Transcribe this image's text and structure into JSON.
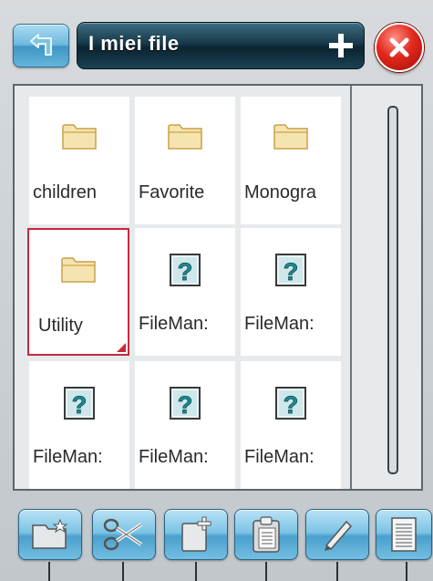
{
  "header": {
    "title": "I miei file"
  },
  "files": [
    {
      "label": "children",
      "type": "folder",
      "selected": false
    },
    {
      "label": "Favorite",
      "type": "folder",
      "selected": false
    },
    {
      "label": "Monogra",
      "type": "folder",
      "selected": false
    },
    {
      "label": "Utility",
      "type": "folder",
      "selected": true
    },
    {
      "label": "FileMan:",
      "type": "unknown",
      "selected": false
    },
    {
      "label": "FileMan:",
      "type": "unknown",
      "selected": false
    },
    {
      "label": "FileMan:",
      "type": "unknown",
      "selected": false
    },
    {
      "label": "FileMan:",
      "type": "unknown",
      "selected": false
    },
    {
      "label": "FileMan:",
      "type": "unknown",
      "selected": false
    }
  ],
  "toolbar": {
    "buttons": [
      "new-folder",
      "cut",
      "new-file",
      "paste",
      "rename",
      "properties"
    ]
  },
  "colors": {
    "accent_blue": "#6fb9dd",
    "title_bar": "#17394a",
    "close_red": "#e2281c",
    "selection_border": "#c8283b",
    "folder_fill": "#f6e4b0"
  }
}
